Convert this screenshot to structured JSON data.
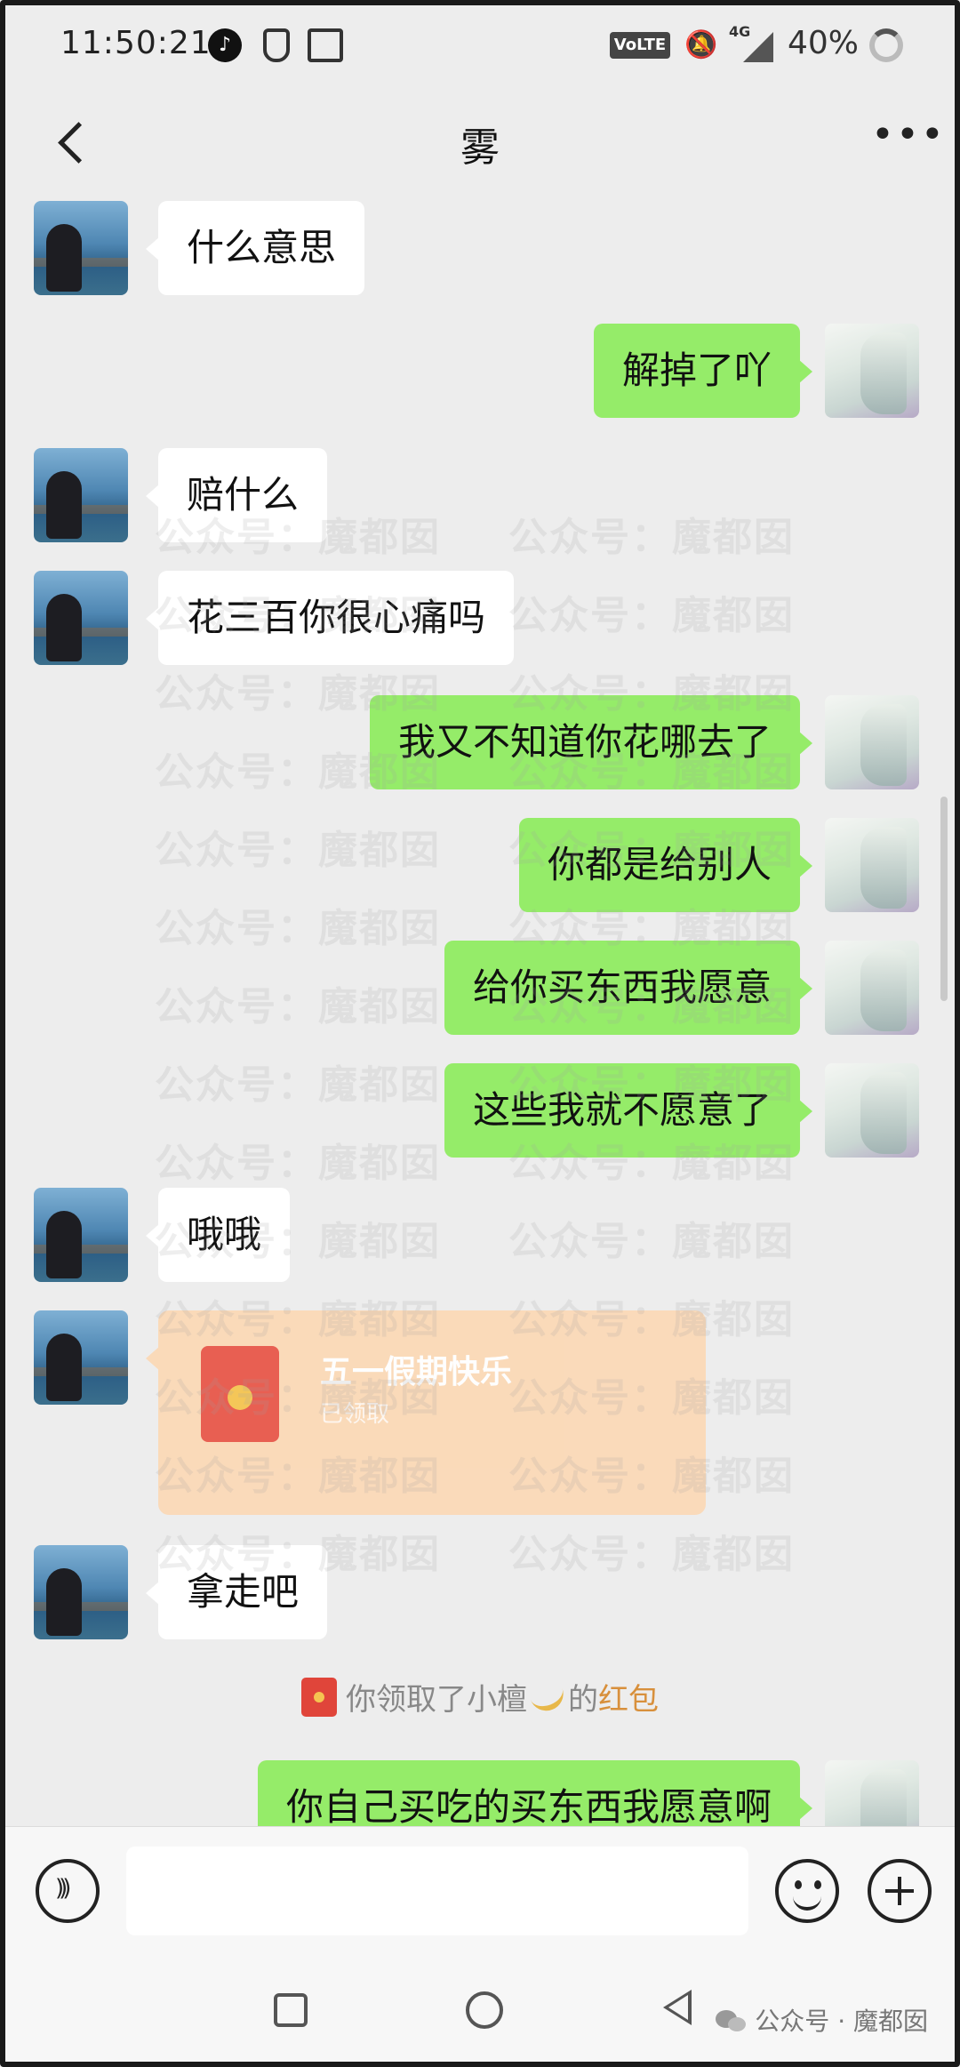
{
  "status_bar": {
    "time": "11:50:21",
    "volte_label": "VoLTE",
    "network_label": "4G",
    "battery": "40%",
    "icons": [
      "tiktok-icon",
      "shield-icon",
      "message-icon",
      "volte-icon",
      "mute-icon",
      "signal-icon",
      "battery-icon"
    ]
  },
  "header": {
    "title": "雾"
  },
  "messages": [
    {
      "from": "them",
      "text": "什么意思"
    },
    {
      "from": "me",
      "text": "解掉了吖"
    },
    {
      "from": "them",
      "text": "赔什么"
    },
    {
      "from": "them",
      "text": "花三百你很心痛吗"
    },
    {
      "from": "me",
      "text": "我又不知道你花哪去了"
    },
    {
      "from": "me",
      "text": "你都是给别人"
    },
    {
      "from": "me",
      "text": "给你买东西我愿意"
    },
    {
      "from": "me",
      "text": "这些我就不愿意了"
    },
    {
      "from": "them",
      "text": "哦哦"
    },
    {
      "from": "them",
      "type": "red_packet",
      "title": "五一假期快乐",
      "subtitle": "已领取"
    },
    {
      "from": "them",
      "text": "拿走吧"
    },
    {
      "from": "me",
      "text": "你自己买吃的买东西我愿意啊"
    }
  ],
  "system_notice": {
    "prefix": "你领取了小檀",
    "middle": "的",
    "link": "红包"
  },
  "watermark": "公众号：魔都囡",
  "input_bar": {
    "placeholder": ""
  },
  "footer_credit": "公众号 · 魔都囡",
  "colors": {
    "background": "#ededed",
    "my_bubble": "#95ec69",
    "their_bubble": "#ffffff",
    "red_packet": "#fbd9b7",
    "link": "#d8903c"
  }
}
